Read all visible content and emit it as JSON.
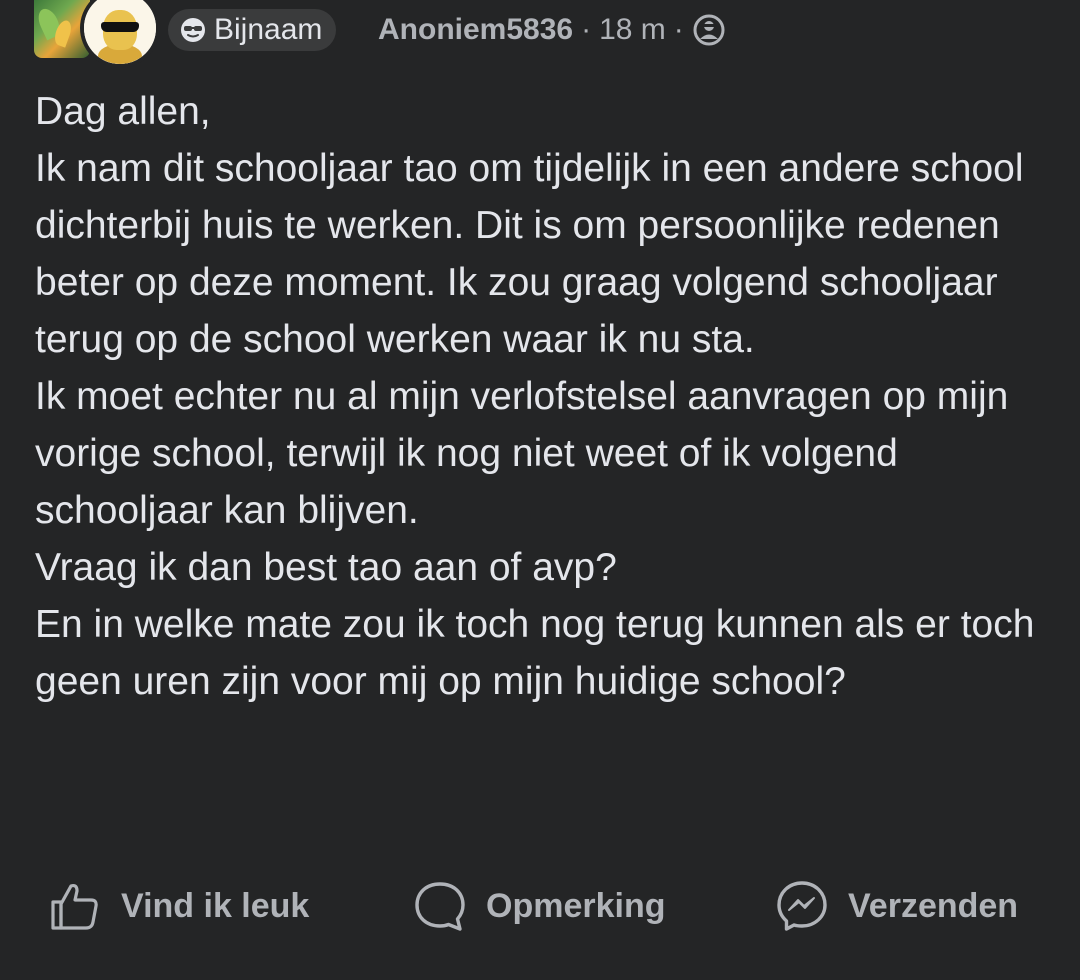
{
  "header": {
    "badge_label": "Bijnaam",
    "badge_icon": "sunglasses-face-icon",
    "author": "Anoniem5836",
    "separator": "·",
    "time": "18 m",
    "privacy_icon": "anonymous-user-icon"
  },
  "post": {
    "paragraphs": [
      "Dag allen,",
      "Ik nam dit schooljaar tao om tijdelijk in een andere school dichterbij huis te werken. Dit is om persoonlijke redenen beter op deze moment. Ik zou graag volgend schooljaar terug op de school werken waar ik nu sta.",
      "Ik moet echter nu al mijn verlofstelsel aanvragen op mijn vorige school, terwijl ik nog niet weet of ik volgend schooljaar kan blijven.",
      "Vraag ik dan best tao aan of avp?",
      "En in welke mate zou ik toch nog terug kunnen als er toch geen uren zijn voor mij op mijn huidige school?"
    ]
  },
  "actions": {
    "like_label": "Vind ik leuk",
    "comment_label": "Opmerking",
    "send_label": "Verzenden"
  },
  "colors": {
    "background": "#242526",
    "text_primary": "#e4e6eb",
    "text_secondary": "#b0b3b8",
    "badge_bg": "#3a3b3c"
  }
}
